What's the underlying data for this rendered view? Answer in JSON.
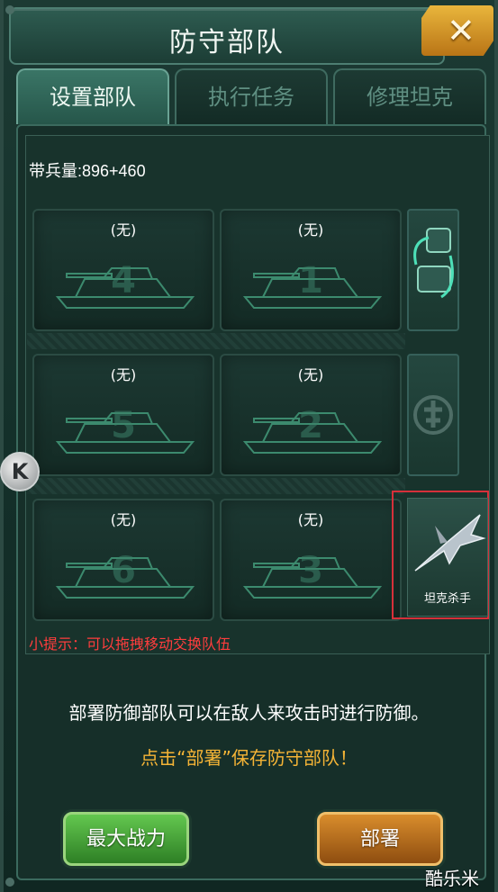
{
  "window": {
    "title": "防守部队",
    "close_icon": "close-icon"
  },
  "tabs": [
    {
      "label": "设置部队",
      "active": true
    },
    {
      "label": "执行任务",
      "active": false
    },
    {
      "label": "修理坦克",
      "active": false
    }
  ],
  "capacity": {
    "text": "带兵量:896+460"
  },
  "slots": [
    {
      "label": "(无)",
      "number": "4"
    },
    {
      "label": "(无)",
      "number": "1"
    },
    {
      "label": "(无)",
      "number": "5"
    },
    {
      "label": "(无)",
      "number": "2"
    },
    {
      "label": "(无)",
      "number": "6"
    },
    {
      "label": "(无)",
      "number": "3"
    }
  ],
  "side_buttons": {
    "swap_icon": "swap-arrows-icon",
    "emblem_icon": "commander-emblem-icon"
  },
  "killer_card": {
    "label": "坦克杀手",
    "icon": "fighter-jet-icon"
  },
  "tip": "小提示：可以拖拽移动交换队伍",
  "description": "部署防御部队可以在敌人来攻击时进行防御。",
  "hint": "点击“部署”保存防守部队！",
  "buttons": {
    "max_power": "最大战力",
    "deploy": "部署"
  },
  "logo": {
    "letter": "K"
  },
  "watermark": "酷乐米",
  "colors": {
    "accent_green": "#2e7f25",
    "accent_orange": "#d98d2c",
    "tip_red": "#ff3d3d",
    "hint_gold": "#f5b436",
    "highlight_red": "#d6303a"
  }
}
